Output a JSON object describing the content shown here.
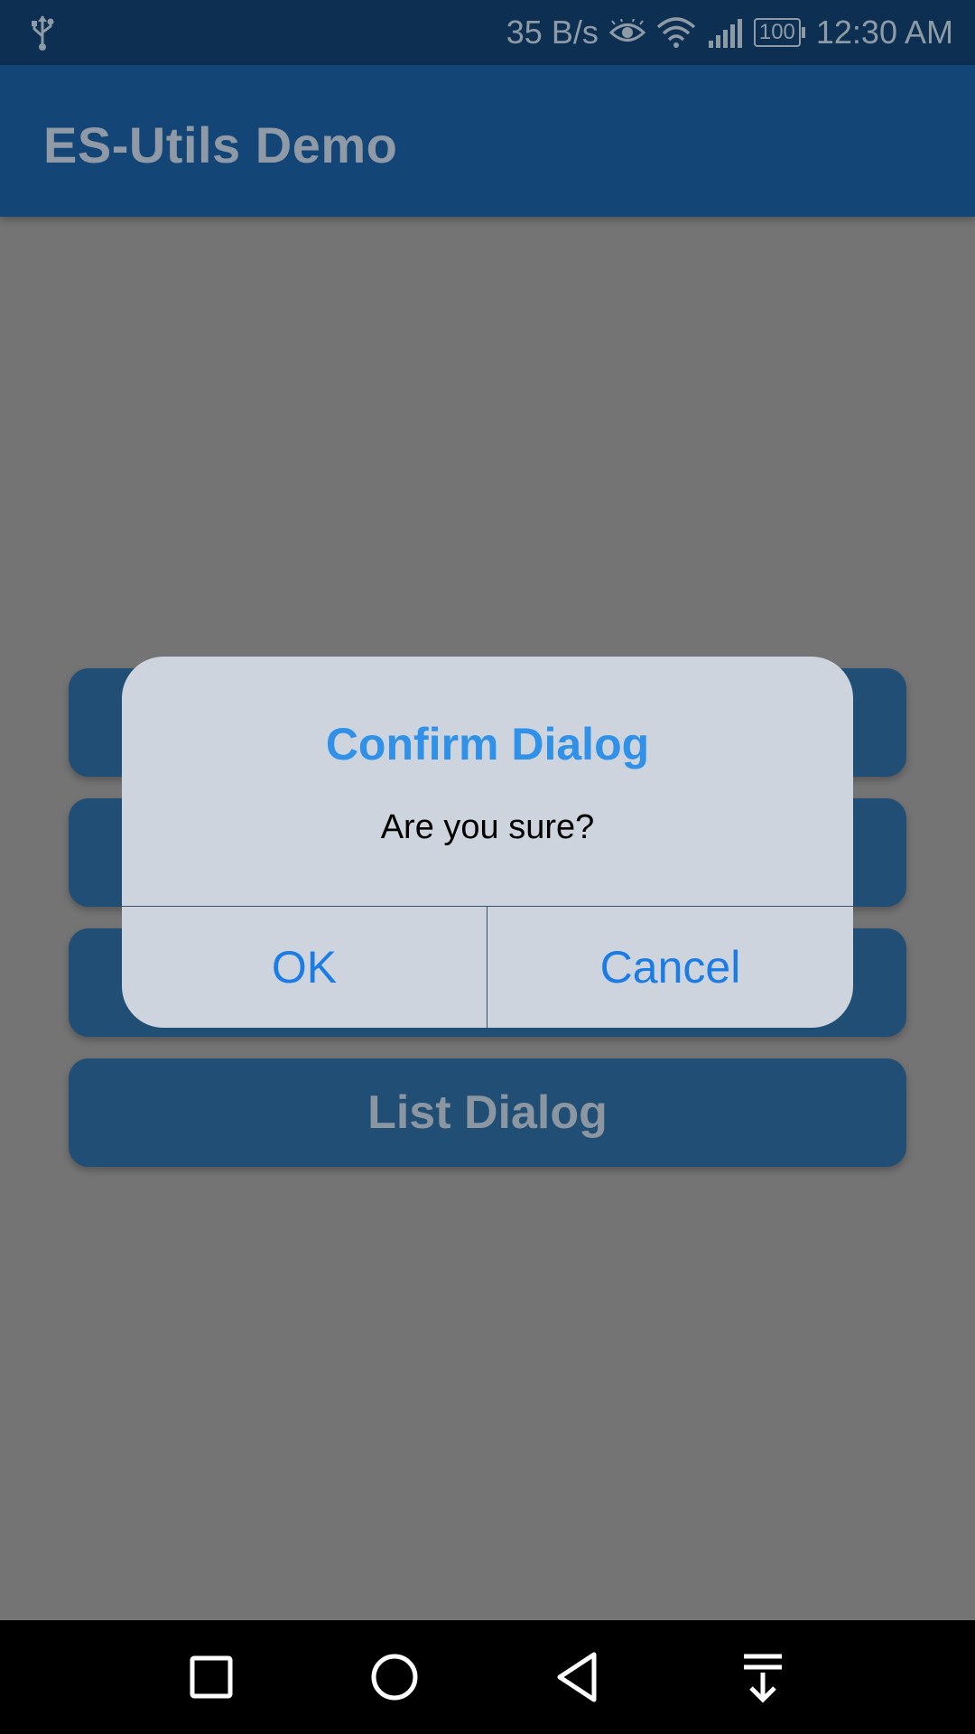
{
  "status_bar": {
    "network_speed": "35 B/s",
    "battery": "100",
    "time": "12:30 AM",
    "icons": [
      "usb-icon",
      "eye-icon",
      "wifi-icon",
      "signal-icon",
      "battery-icon"
    ]
  },
  "app_bar": {
    "title": "ES-Utils Demo"
  },
  "menu": {
    "items": [
      {
        "label": ""
      },
      {
        "label": ""
      },
      {
        "label": ""
      },
      {
        "label": "List Dialog"
      }
    ]
  },
  "dialog": {
    "title": "Confirm Dialog",
    "message": "Are you sure?",
    "ok_label": "OK",
    "cancel_label": "Cancel"
  },
  "nav_bar": {
    "icons": [
      "recent-apps-icon",
      "home-icon",
      "back-icon",
      "notification-drawer-icon"
    ]
  },
  "colors": {
    "status_bar": "#0c2f52",
    "app_bar": "#134677",
    "scrim_background": "#747474",
    "menu_button": "#204e75",
    "dialog_background": "#cdd4dd",
    "dialog_title": "#2f91e8",
    "dialog_button_text": "#1b7ce6"
  }
}
